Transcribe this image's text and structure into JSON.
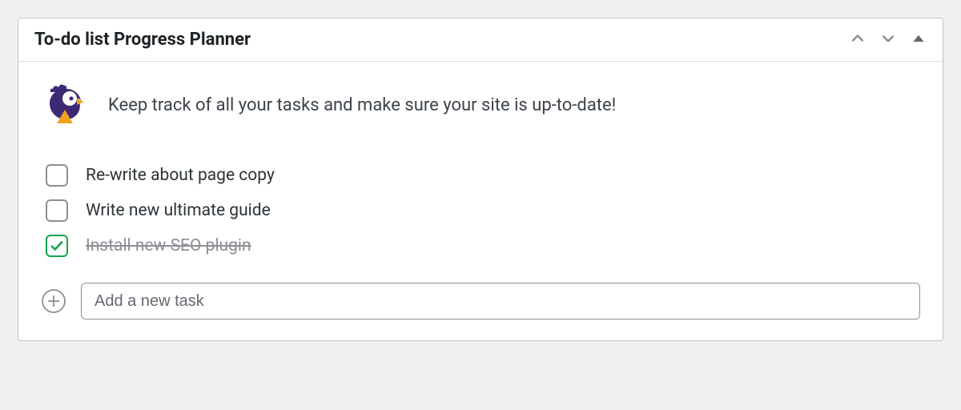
{
  "header": {
    "title": "To-do list Progress Planner"
  },
  "intro": {
    "text": "Keep track of all your tasks and make sure your site is up-to-date!"
  },
  "tasks": [
    {
      "label": "Re-write about page copy",
      "done": false
    },
    {
      "label": "Write new ultimate guide",
      "done": false
    },
    {
      "label": "Install new SEO plugin",
      "done": true
    }
  ],
  "add": {
    "placeholder": "Add a new task"
  },
  "icons": {
    "logo": "progress-planner-rooster-icon",
    "up": "chevron-up-icon",
    "down": "chevron-down-icon",
    "collapse": "triangle-up-icon",
    "plus": "plus-circle-icon",
    "check": "checkmark-icon"
  },
  "colors": {
    "border": "#c3c4c7",
    "text": "#2c3338",
    "muted": "#8c8f94",
    "accent_purple": "#3b2a73",
    "accent_orange": "#f0a020",
    "green": "#14a44d"
  }
}
